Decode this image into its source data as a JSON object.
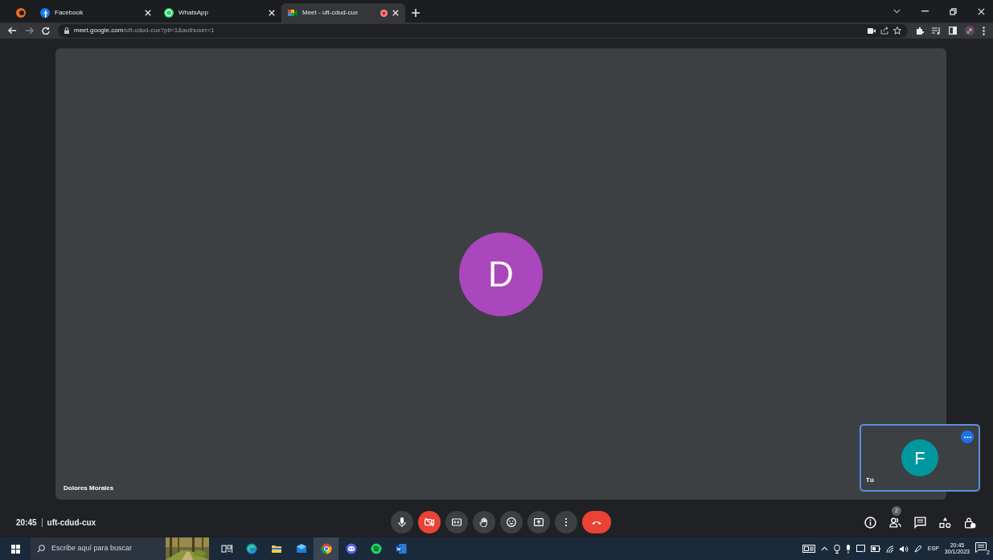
{
  "browser": {
    "tabs": [
      {
        "title": "Facebook",
        "kind": "facebook",
        "selected": false,
        "recording": false
      },
      {
        "title": "WhatsApp",
        "kind": "whatsapp",
        "selected": false,
        "recording": false
      },
      {
        "title": "Meet - uft-cdud-cux",
        "kind": "meet",
        "selected": true,
        "recording": true
      }
    ],
    "url_host": "meet.google.com",
    "url_path": "/uft-cdud-cux?pli=1&authuser=1"
  },
  "main_tile": {
    "initial": "D",
    "name": "Dolores Morales",
    "color": "#ab47bc"
  },
  "self_tile": {
    "initial": "F",
    "name": "Tú",
    "color": "#00979f",
    "selected": true
  },
  "meeting": {
    "time": "20:45",
    "code": "uft-cdud-cux"
  },
  "controls": [
    {
      "kind": "mic",
      "off": false
    },
    {
      "kind": "camera",
      "off": true
    },
    {
      "kind": "captions",
      "off": false
    },
    {
      "kind": "hand",
      "off": false
    },
    {
      "kind": "emoji",
      "off": false
    },
    {
      "kind": "present",
      "off": false
    },
    {
      "kind": "more",
      "off": false
    },
    {
      "kind": "hangup"
    }
  ],
  "side_controls": [
    {
      "kind": "info"
    },
    {
      "kind": "people",
      "count": "2"
    },
    {
      "kind": "chat"
    },
    {
      "kind": "activities"
    },
    {
      "kind": "host"
    }
  ],
  "taskbar": {
    "search_placeholder": "Escribe aquí para buscar",
    "apps": [
      {
        "kind": "taskview",
        "selected": false
      },
      {
        "kind": "edge",
        "selected": false
      },
      {
        "kind": "explorer",
        "selected": false
      },
      {
        "kind": "mail",
        "selected": false
      },
      {
        "kind": "chrome",
        "selected": true
      },
      {
        "kind": "discord",
        "selected": false
      },
      {
        "kind": "spotify",
        "selected": false
      },
      {
        "kind": "word",
        "selected": false
      }
    ],
    "language": "ESP",
    "time": "20:45",
    "date": "30/1/2023",
    "notifications": "2"
  }
}
